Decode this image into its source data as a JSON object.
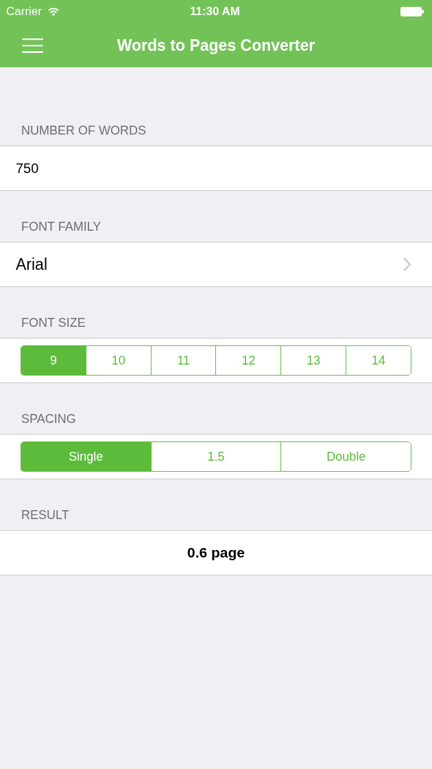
{
  "status_bar": {
    "carrier": "Carrier",
    "time": "11:30 AM"
  },
  "nav_bar": {
    "title": "Words to Pages Converter"
  },
  "sections": [
    {
      "kind": "input",
      "header": "NUMBER OF WORDS",
      "value": "750"
    },
    {
      "kind": "disclosure",
      "header": "FONT FAMILY",
      "value": "Arial"
    },
    {
      "kind": "segmented",
      "header": "FONT SIZE",
      "options": [
        {
          "label": "9",
          "selected": true
        },
        {
          "label": "10",
          "selected": false
        },
        {
          "label": "11",
          "selected": false
        },
        {
          "label": "12",
          "selected": false
        },
        {
          "label": "13",
          "selected": false
        },
        {
          "label": "14",
          "selected": false
        }
      ]
    },
    {
      "kind": "segmented",
      "header": "SPACING",
      "options": [
        {
          "label": "Single",
          "selected": true
        },
        {
          "label": "1.5",
          "selected": false
        },
        {
          "label": "Double",
          "selected": false
        }
      ]
    },
    {
      "kind": "result",
      "header": "RESULT",
      "value": "0.6 page"
    }
  ]
}
